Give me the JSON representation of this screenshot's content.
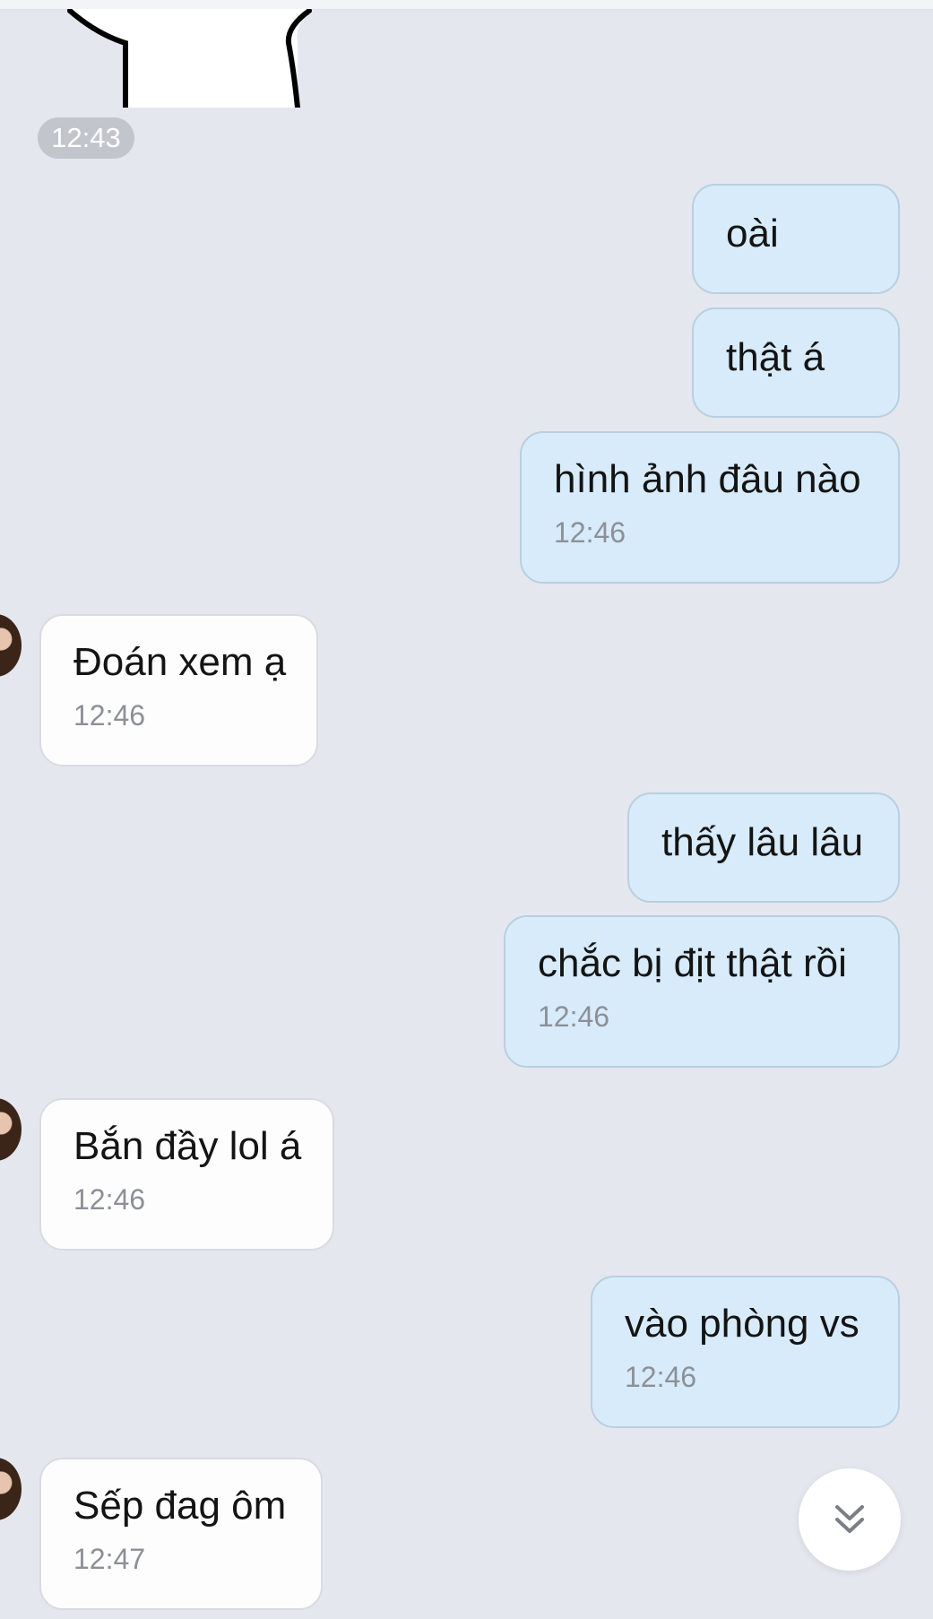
{
  "chat": {
    "time_separator": "12:43",
    "messages": [
      {
        "side": "out",
        "text": "oài"
      },
      {
        "side": "out",
        "text": "thật á"
      },
      {
        "side": "out",
        "text": "hình ảnh đâu nào",
        "time": "12:46"
      },
      {
        "side": "in",
        "text": "Đoán xem ạ",
        "time": "12:46"
      },
      {
        "side": "out",
        "text": "thấy lâu lâu"
      },
      {
        "side": "out",
        "text": "chắc bị địt thật rồi",
        "time": "12:46"
      },
      {
        "side": "in",
        "text": "Bắn đầy lol á",
        "time": "12:46"
      },
      {
        "side": "out",
        "text": "vào phòng vs",
        "time": "12:46"
      },
      {
        "side": "in",
        "text": "Sếp đag ôm",
        "time": "12:47"
      }
    ]
  },
  "icons": {
    "scroll_down": "double-chevron-down-icon",
    "avatar": "contact-avatar"
  },
  "colors": {
    "background": "#e4e7ee",
    "outgoing_bubble": "#d7ebfa",
    "incoming_bubble": "#fdfdfd",
    "timestamp_text": "#8c9096"
  }
}
